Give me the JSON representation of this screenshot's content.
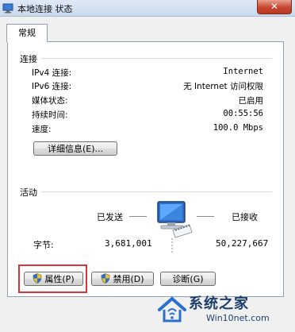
{
  "window": {
    "title": "本地连接 状态",
    "close_symbol": "✕"
  },
  "tab": {
    "label": "常规"
  },
  "connection": {
    "header": "连接",
    "rows": [
      {
        "label": "IPv4 连接:",
        "value": "Internet"
      },
      {
        "label": "IPv6 连接:",
        "value": "无 Internet 访问权限"
      },
      {
        "label": "媒体状态:",
        "value": "已启用"
      },
      {
        "label": "持续时间:",
        "value": "00:55:56"
      },
      {
        "label": "速度:",
        "value": "100.0 Mbps"
      }
    ],
    "details_button": "详细信息(E)..."
  },
  "activity": {
    "header": "活动",
    "sent_label": "已发送",
    "received_label": "已接收",
    "bytes_label": "字节:",
    "bytes_sent": "3,681,001",
    "bytes_received": "50,227,667"
  },
  "buttons": {
    "properties": "属性(P)",
    "disable": "禁用(D)",
    "diagnose": "诊断(G)"
  },
  "watermark": {
    "title": "系统之家",
    "url": "Win10net.com"
  }
}
